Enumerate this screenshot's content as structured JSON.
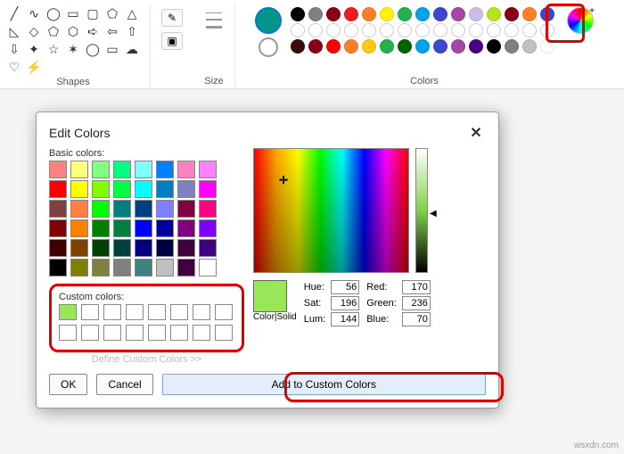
{
  "ribbon": {
    "shapes_label": "Shapes",
    "size_label": "Size",
    "colors_label": "Colors",
    "current_color1": "#009688",
    "current_color2": "#ffffff",
    "row1": [
      "#000000",
      "#7f7f7f",
      "#880015",
      "#ed1c24",
      "#ff7f27",
      "#fff200",
      "#22b14c",
      "#00a2e8",
      "#3f48cc",
      "#a349a4",
      "#c8bfe7",
      "#b5e61d",
      "#880015",
      "#ff7f27",
      "#3f48cc"
    ],
    "row2_mode": "empty",
    "row3": [
      "#3b0b0b",
      "#880015",
      "#ff0000",
      "#ff7f27",
      "#ffc90e",
      "#22b14c",
      "#006400",
      "#00a2e8",
      "#3f48cc",
      "#a349a4",
      "#4b0082",
      "#000000",
      "#808080",
      "#c0c0c0",
      "#ffffff"
    ]
  },
  "dialog": {
    "title": "Edit Colors",
    "close_glyph": "✕",
    "basic_label": "Basic colors:",
    "basic_colors": [
      [
        "#ff8080",
        "#ffff80",
        "#80ff80",
        "#00ff80",
        "#80ffff",
        "#0080ff",
        "#ff80c0",
        "#ff80ff"
      ],
      [
        "#ff0000",
        "#ffff00",
        "#80ff00",
        "#00ff40",
        "#00ffff",
        "#0080c0",
        "#8080c0",
        "#ff00ff"
      ],
      [
        "#804040",
        "#ff8040",
        "#00ff00",
        "#008080",
        "#004080",
        "#8080ff",
        "#800040",
        "#ff0080"
      ],
      [
        "#800000",
        "#ff8000",
        "#008000",
        "#008040",
        "#0000ff",
        "#0000a0",
        "#800080",
        "#8000ff"
      ],
      [
        "#400000",
        "#804000",
        "#004000",
        "#004040",
        "#000080",
        "#000040",
        "#400040",
        "#400080"
      ],
      [
        "#000000",
        "#808000",
        "#808040",
        "#808080",
        "#408080",
        "#c0c0c0",
        "#400040",
        "#ffffff"
      ]
    ],
    "custom_label": "Custom colors:",
    "custom_colors": [
      "#99e657",
      "",
      "",
      "",
      "",
      "",
      "",
      "",
      "",
      "",
      "",
      "",
      "",
      "",
      "",
      ""
    ],
    "define_label": "Define Custom Colors >>",
    "preview_color": "#99e657",
    "preview_label": "Color|Solid",
    "hue_label": "Hue:",
    "sat_label": "Sat:",
    "lum_label": "Lum:",
    "red_label": "Red:",
    "green_label": "Green:",
    "blue_label": "Blue:",
    "hue": "56",
    "sat": "196",
    "lum": "144",
    "red": "170",
    "green": "236",
    "blue": "70",
    "ok_label": "OK",
    "cancel_label": "Cancel",
    "add_label": "Add to Custom Colors"
  },
  "watermark": "wsxdn.com"
}
